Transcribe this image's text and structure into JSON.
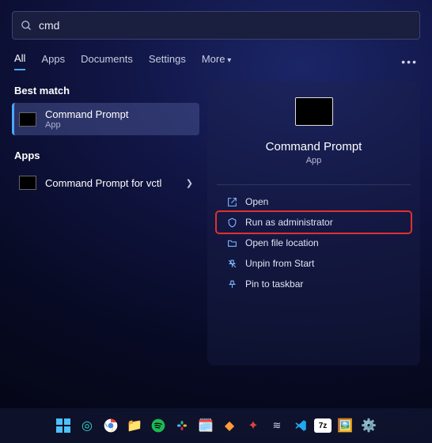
{
  "search": {
    "value": "cmd"
  },
  "tabs": {
    "all": "All",
    "apps": "Apps",
    "documents": "Documents",
    "settings": "Settings",
    "more": "More"
  },
  "left": {
    "bestmatch_hdr": "Best match",
    "bestmatch": {
      "title": "Command Prompt",
      "subtitle": "App"
    },
    "apps_hdr": "Apps",
    "app1": {
      "title": "Command Prompt for vctl"
    }
  },
  "preview": {
    "title": "Command Prompt",
    "subtitle": "App"
  },
  "actions": {
    "open": "Open",
    "runadmin": "Run as administrator",
    "openloc": "Open file location",
    "unpin": "Unpin from Start",
    "pintb": "Pin to taskbar"
  }
}
